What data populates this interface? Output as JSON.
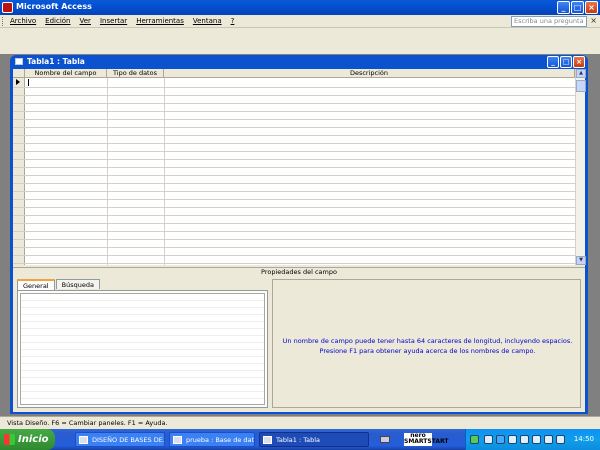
{
  "app": {
    "title": "Microsoft Access"
  },
  "menu": {
    "items": [
      "Archivo",
      "Edición",
      "Ver",
      "Insertar",
      "Herramientas",
      "Ventana",
      "?"
    ],
    "help_placeholder": "Escriba una pregunta"
  },
  "child": {
    "title": "Tabla1 : Tabla"
  },
  "grid": {
    "columns": [
      "Nombre del campo",
      "Tipo de datos",
      "Descripción"
    ]
  },
  "properties": {
    "label": "Propiedades del campo",
    "tabs": [
      "General",
      "Búsqueda"
    ],
    "help_text": "Un nombre de campo puede tener hasta 64 caracteres de longitud, incluyendo espacios. Presione F1 para obtener ayuda acerca de los nombres de campo."
  },
  "status": {
    "text": "Vista Diseño.  F6 = Cambiar paneles.  F1 = Ayuda."
  },
  "taskbar": {
    "start_label": "Inicio",
    "tasks": [
      "DISEÑO DE BASES DE...",
      "prueba : Base de dat...",
      "Tabla1 : Tabla"
    ],
    "nero_label": "nero SMARTSTART",
    "clock": "14:50"
  }
}
